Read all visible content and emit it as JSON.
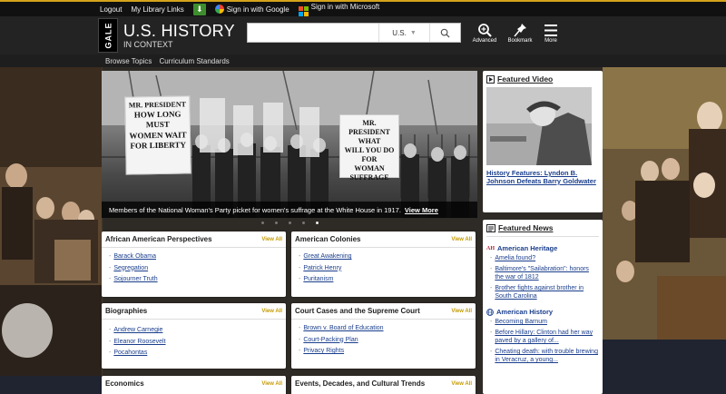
{
  "topbar": {
    "logout": "Logout",
    "library_links": "My Library Links",
    "download_icon": "download-icon",
    "google_signin": "Sign in with Google",
    "microsoft_signin": "Sign in with Microsoft"
  },
  "header": {
    "gale": "GALE",
    "title": "U.S. HISTORY",
    "subtitle": "IN CONTEXT",
    "search_placeholder": "",
    "scope": "U.S.",
    "tools": [
      {
        "label": "Advanced",
        "icon": "advanced-search-icon"
      },
      {
        "label": "Bookmark",
        "icon": "bookmark-pin-icon"
      },
      {
        "label": "More",
        "icon": "menu-icon"
      }
    ]
  },
  "subnav": {
    "browse_topics": "Browse Topics",
    "curriculum_standards": "Curriculum Standards"
  },
  "hero": {
    "sign_left": [
      "MR. PRESIDENT",
      "HOW LONG",
      "MUST",
      "WOMEN WAIT",
      "FOR LIBERTY"
    ],
    "sign_right": [
      "MR. PRESIDENT",
      "WHAT",
      "WILL YOU DO",
      "FOR",
      "WOMAN SUFFRAGE"
    ],
    "caption": "Members of the National Woman's Party picket for women's suffrage at the White House in 1917.",
    "view_more": "View More",
    "slide_count": 5,
    "active_slide": 5
  },
  "cards": [
    {
      "title": "African American Perspectives",
      "view_all": "View All",
      "items": [
        "Barack Obama",
        "Segregation",
        "Sojourner Truth"
      ]
    },
    {
      "title": "American Colonies",
      "view_all": "View All",
      "items": [
        "Great Awakening",
        "Patrick Henry",
        "Puritanism"
      ]
    },
    {
      "title": "Biographies",
      "view_all": "View All",
      "items": [
        "Andrew Carnegie",
        "Eleanor Roosevelt",
        "Pocahontas"
      ]
    },
    {
      "title": "Court Cases and the Supreme Court",
      "view_all": "View All",
      "items": [
        "Brown v. Board of Education",
        "Court-Packing Plan",
        "Privacy Rights"
      ]
    },
    {
      "title": "Economics",
      "view_all": "View All",
      "items": []
    },
    {
      "title": "Events, Decades, and Cultural Trends",
      "view_all": "View All",
      "items": []
    }
  ],
  "featured_video": {
    "heading": "Featured Video",
    "title": "History Features: Lyndon B. Johnson Defeats Barry Goldwater"
  },
  "featured_news": {
    "heading": "Featured News",
    "sources": [
      {
        "name": "American Heritage",
        "badge": "AH",
        "items": [
          "Amelia found?",
          "Baltimore's \"Sailabration\": honors the war of 1812",
          "Brother fights against brother in South Carolina"
        ]
      },
      {
        "name": "American History",
        "badge": "",
        "items": [
          "Becoming Barnum",
          "Before Hillary: Clinton had her way paved by a gallery of...",
          "Cheating death: with trouble brewing in Veracruz, a young..."
        ]
      }
    ]
  },
  "colors": {
    "accent": "#d4a21b",
    "link": "#1a3e8c",
    "view_all": "#c49a00"
  }
}
